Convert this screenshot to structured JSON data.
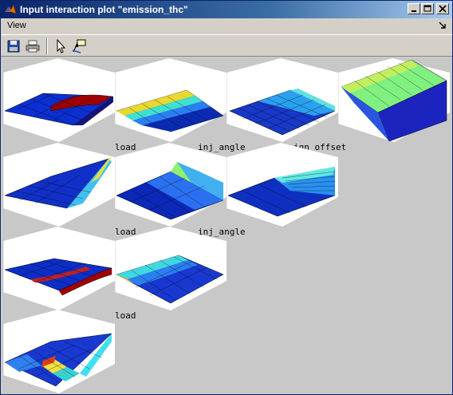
{
  "window": {
    "title": "Input interaction plot \"emission_thc\""
  },
  "menu": {
    "items": [
      "View"
    ]
  },
  "toolbar": {
    "icons": [
      "save-icon",
      "print-icon",
      "pointer-icon",
      "data-cursor-icon"
    ]
  },
  "plots": {
    "labels": {
      "row1_col1": "load",
      "row1_col2": "inj_angle",
      "row1_col3": "ign_offset",
      "row2_col1": "load",
      "row2_col2": "inj_angle",
      "row3_col1": "load"
    }
  },
  "colors": {
    "titlebar_start": "#0a246a",
    "plot_background": "#c8c8c8",
    "surface_low": "#0000aa",
    "surface_high": "#aa0000"
  }
}
